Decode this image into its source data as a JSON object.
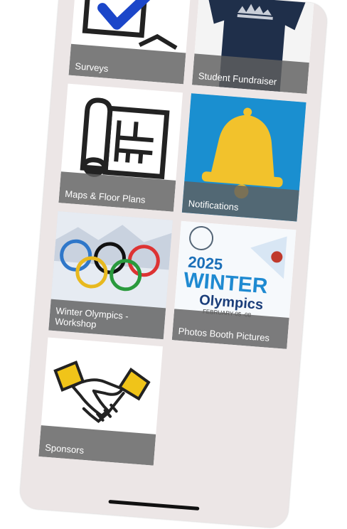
{
  "tiles": [
    {
      "id": "surveys",
      "label": "Surveys",
      "icon": "checkbox-check-icon"
    },
    {
      "id": "student-fundraiser",
      "label": "Student Fundraiser",
      "icon": "tshirt-icon"
    },
    {
      "id": "maps",
      "label": "Maps & Floor Plans",
      "icon": "floor-plan-icon"
    },
    {
      "id": "notifications",
      "label": "Notifications",
      "icon": "bell-icon"
    },
    {
      "id": "winter-workshop",
      "label": "Winter Olympics - Workshop",
      "icon": "olympic-rings-icon"
    },
    {
      "id": "photos",
      "label": "Photos Booth Pictures",
      "icon": "winter-olympics-poster-icon",
      "poster": {
        "year": "2025",
        "title1": "WINTER",
        "title2": "Olympics",
        "dates": "FEBRUARY 05 -08"
      }
    },
    {
      "id": "sponsors",
      "label": "Sponsors",
      "icon": "handshake-icon"
    }
  ],
  "colors": {
    "background": "#ece6e6",
    "label_bg": "#5f5f5f",
    "bell_bg": "#1a8fd0",
    "bell": "#f2c22c",
    "navy_shirt": "#1f2f4a",
    "handshake_cuff": "#f0c419"
  }
}
